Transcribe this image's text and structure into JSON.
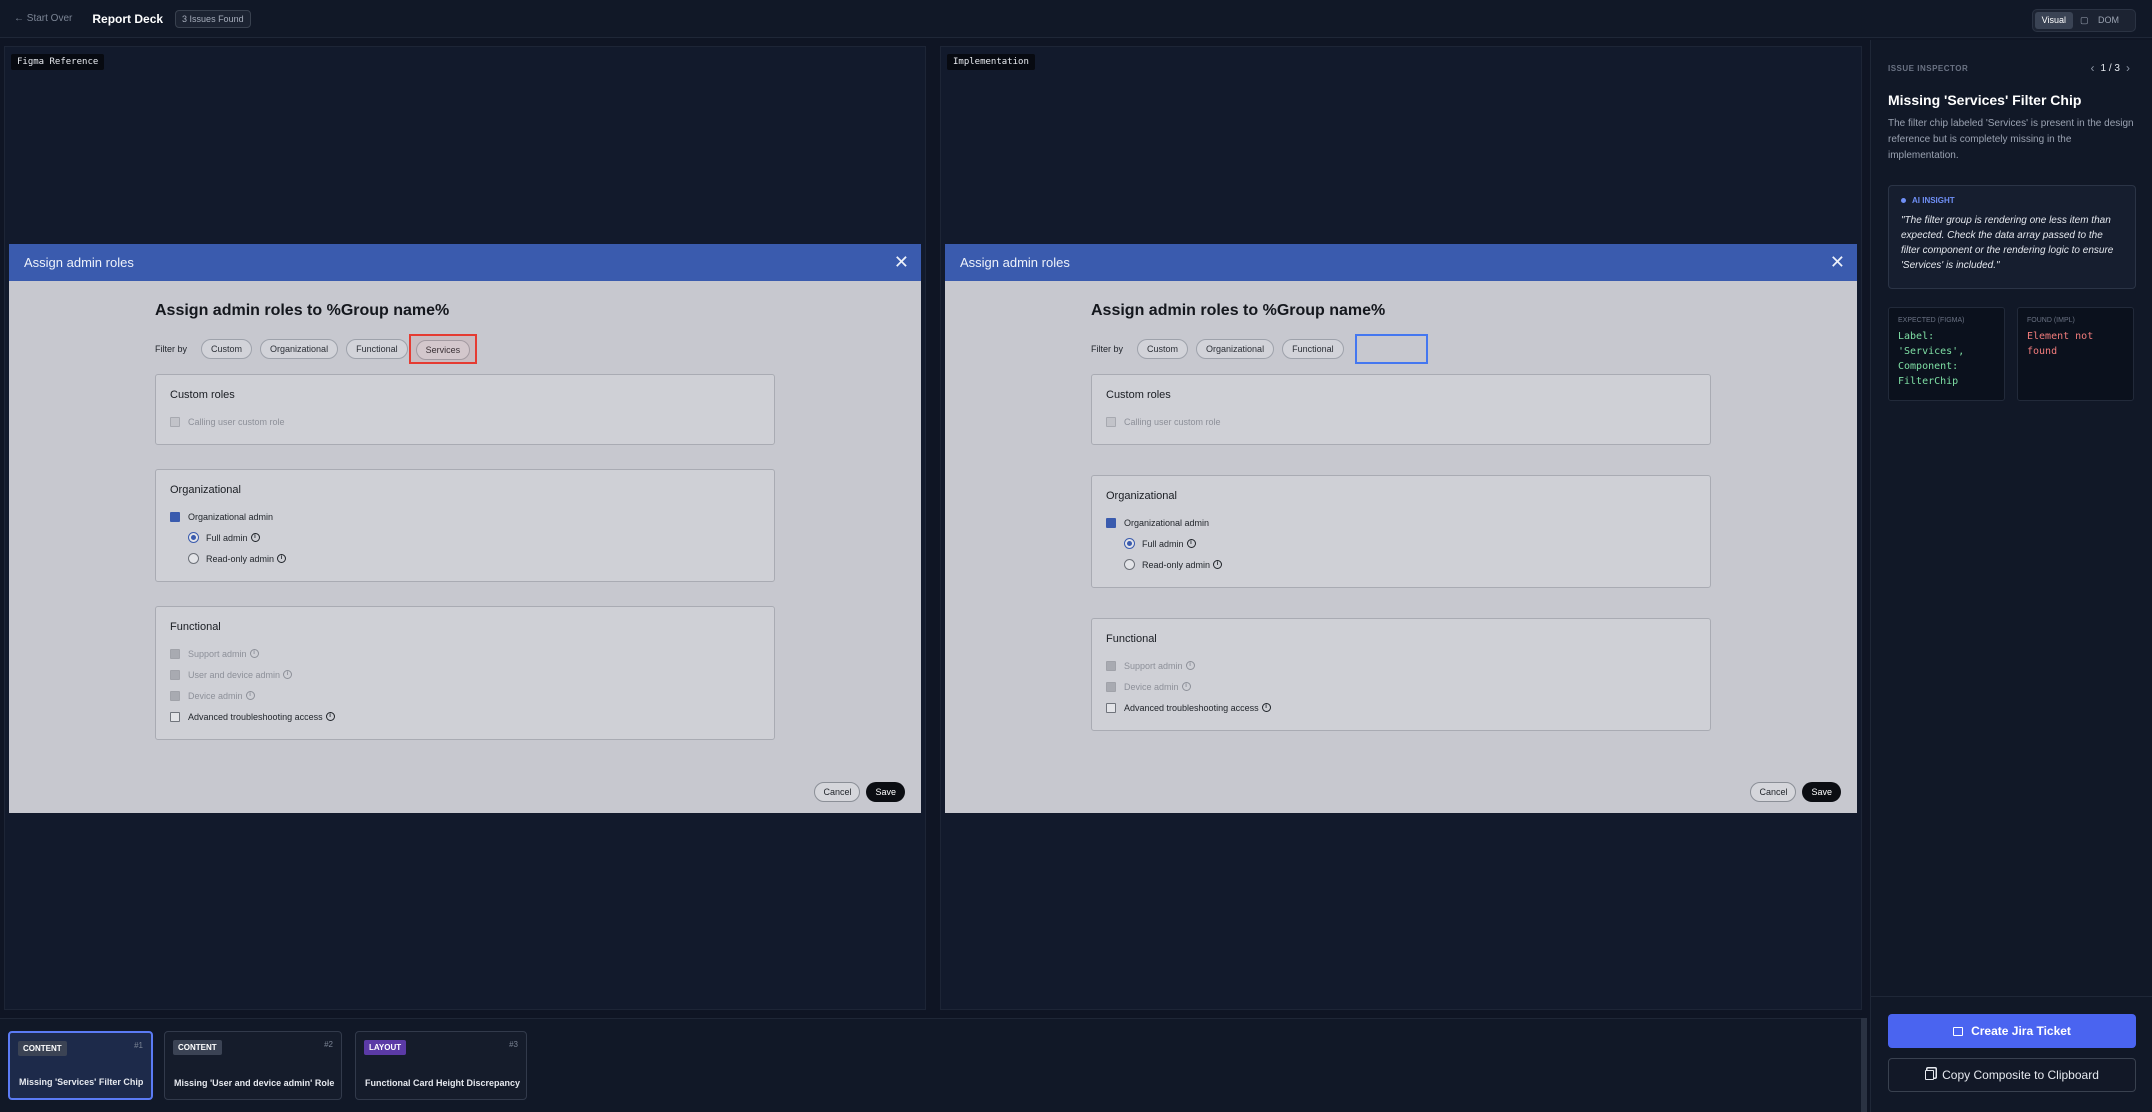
{
  "topbar": {
    "back_label": "← Start Over",
    "title": "Report Deck",
    "issues_badge": "3 Issues Found",
    "toggle": {
      "visual": "Visual",
      "dom": "DOM"
    }
  },
  "panes": {
    "left_tag": "Figma Reference",
    "right_tag": "Implementation"
  },
  "dialog": {
    "header": "Assign admin roles",
    "close_glyph": "✕",
    "title": "Assign admin roles to %Group name%",
    "filter_label": "Filter by",
    "chips": [
      "Custom",
      "Organizational",
      "Functional",
      "Services"
    ],
    "custom_roles": {
      "title": "Custom roles",
      "items": [
        "Calling user custom role"
      ]
    },
    "organizational": {
      "title": "Organizational",
      "checkbox": "Organizational admin",
      "radios": [
        "Full admin",
        "Read-only admin"
      ]
    },
    "functional": {
      "title": "Functional",
      "items_figma": [
        "Support admin",
        "User and device admin",
        "Device admin",
        "Advanced troubleshooting access"
      ],
      "items_impl": [
        "Support admin",
        "Device admin",
        "Advanced troubleshooting access"
      ]
    },
    "info_glyph": "i",
    "cancel": "Cancel",
    "save": "Save"
  },
  "inspector": {
    "label": "ISSUE INSPECTOR",
    "pager": "1 / 3",
    "prev": "‹",
    "next": "›",
    "title": "Missing 'Services' Filter Chip",
    "description": "The filter chip labeled 'Services' is present in the design reference but is completely missing in the implementation.",
    "insight_label": "AI INSIGHT",
    "insight_text": "\"The filter group is rendering one less item than expected. Check the data array passed to the filter component or the rendering logic to ensure 'Services' is included.\"",
    "expected_label": "EXPECTED (FIGMA)",
    "expected_value": "Label:\n'Services',\nComponent:\nFilterChip",
    "found_label": "FOUND (IMPL)",
    "found_value": "Element not\nfound",
    "jira_button": "Create Jira Ticket",
    "copy_button": "Copy Composite to Clipboard"
  },
  "issues": [
    {
      "category": "CONTENT",
      "number": "#1",
      "title": "Missing 'Services' Filter Chip"
    },
    {
      "category": "CONTENT",
      "number": "#2",
      "title": "Missing 'User and device admin' Role"
    },
    {
      "category": "LAYOUT",
      "number": "#3",
      "title": "Functional Card Height Discrepancy"
    }
  ],
  "colors": {
    "accent": "#4a64f0",
    "dialog_header": "#3a5bae",
    "highlight_expected": "#e53b32",
    "highlight_found": "#4477f0",
    "layout_tag": "#5b3aa6"
  }
}
